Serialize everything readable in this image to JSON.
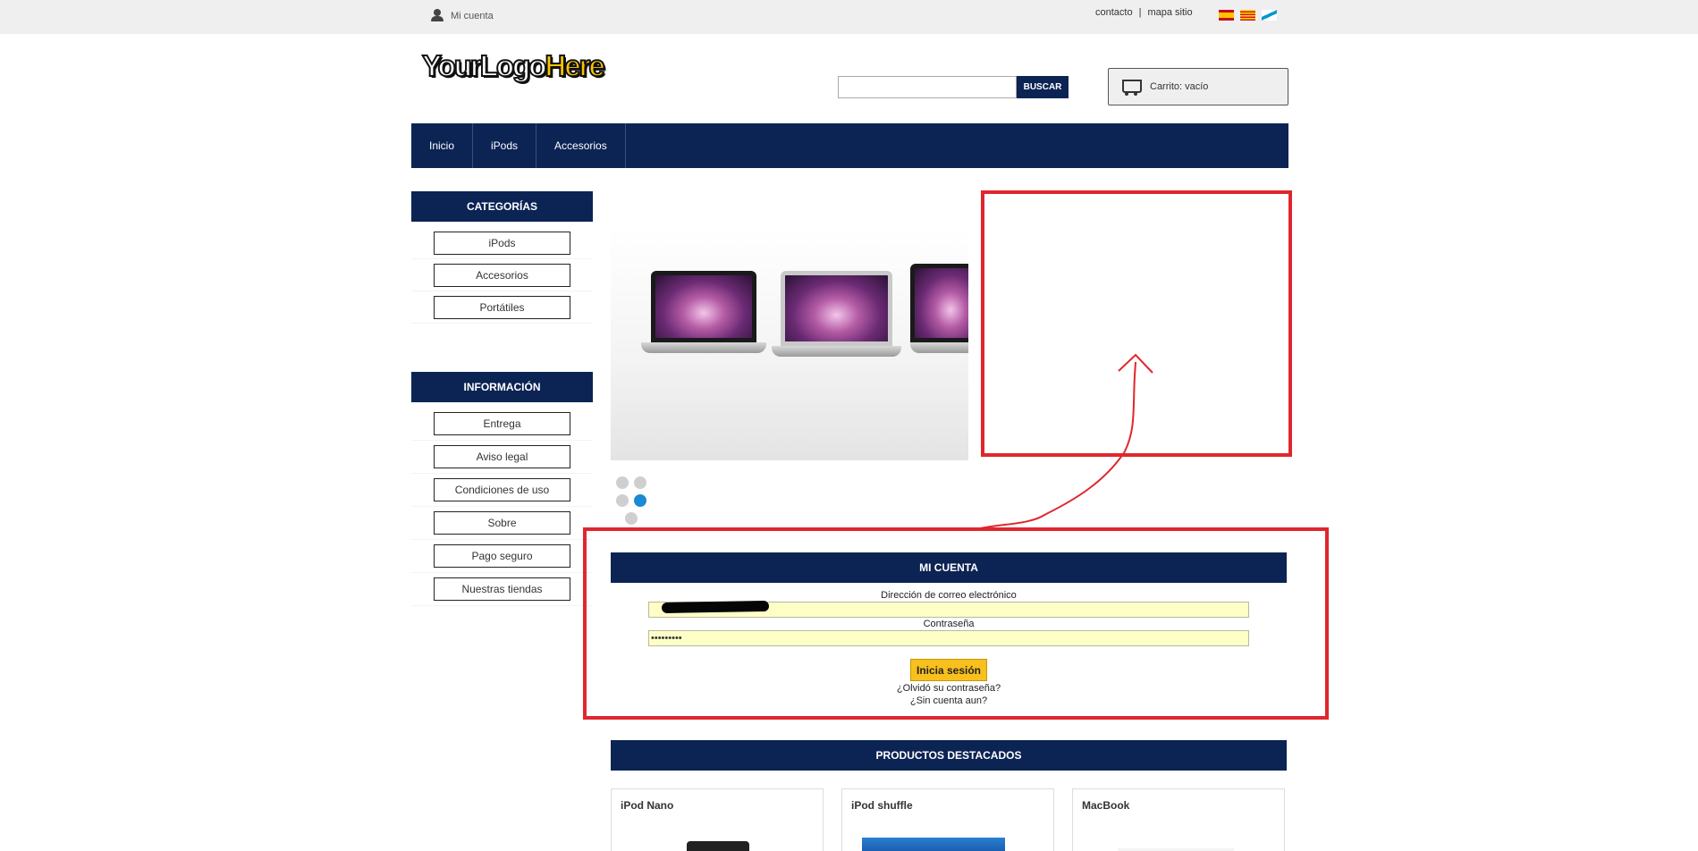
{
  "topbar": {
    "my_account": "Mi cuenta",
    "links": [
      "contacto",
      "mapa sitio"
    ],
    "separator": "|",
    "flags": [
      "flag-es-icon",
      "flag-ca-icon",
      "flag-gl-icon"
    ]
  },
  "header": {
    "logo_part1": "YourLogo",
    "logo_part2": "Here",
    "search_placeholder": "",
    "search_button": "BUSCAR",
    "cart_label": "Carrito: vacío"
  },
  "nav": {
    "items": [
      "Inicio",
      "iPods",
      "Accesorios"
    ]
  },
  "sidebar": {
    "categories_title": "CATEGORÍAS",
    "categories": [
      "iPods",
      "Accesorios",
      "Portátiles"
    ],
    "info_title": "INFORMACIÓN",
    "info": [
      "Entrega",
      "Aviso legal",
      "Condiciones de uso",
      "Sobre",
      "Pago seguro",
      "Nuestras tiendas"
    ]
  },
  "slider": {
    "dots_active_index": 3
  },
  "account": {
    "title": "MI CUENTA",
    "email_label": "Dirección de correo electrónico",
    "password_label": "Contraseña",
    "password_value": "•••••••••",
    "login_button": "Inicia sesión",
    "forgot_link": "¿Olvidó su contraseña?",
    "no_account_link": "¿Sin cuenta aun?"
  },
  "featured": {
    "title": "PRODUCTOS DESTACADOS",
    "products": [
      "iPod Nano",
      "iPod shuffle",
      "MacBook"
    ]
  },
  "colors": {
    "navy": "#0c2454",
    "accent_yellow": "#f8c01c",
    "annotation_red": "#e0262d"
  }
}
